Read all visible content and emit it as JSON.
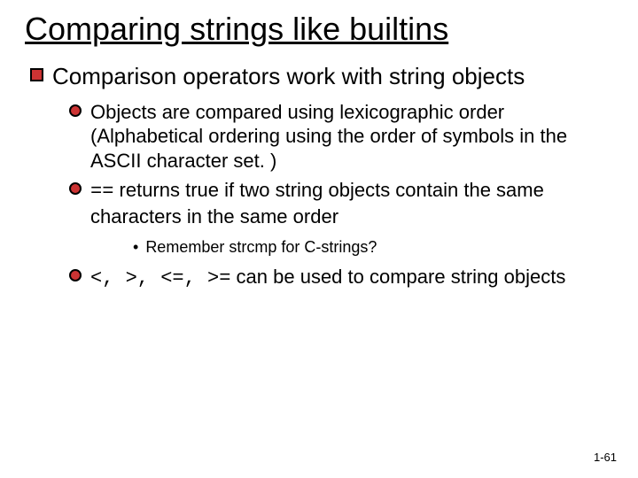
{
  "title": "Comparing strings like builtins",
  "bullet1": "Comparison operators work with string objects",
  "sub1": "Objects are compared using lexicographic order (Alphabetical ordering using the order of symbols in the ASCII character set. )",
  "sub2_code": "==",
  "sub2_rest": " returns true if two string objects contain the same characters in the same order",
  "subsub": "Remember strcmp for C-strings?",
  "sub3_ops": "<, >, <=, >=",
  "sub3_rest": " can be used to compare string objects",
  "page_number": "1-61"
}
